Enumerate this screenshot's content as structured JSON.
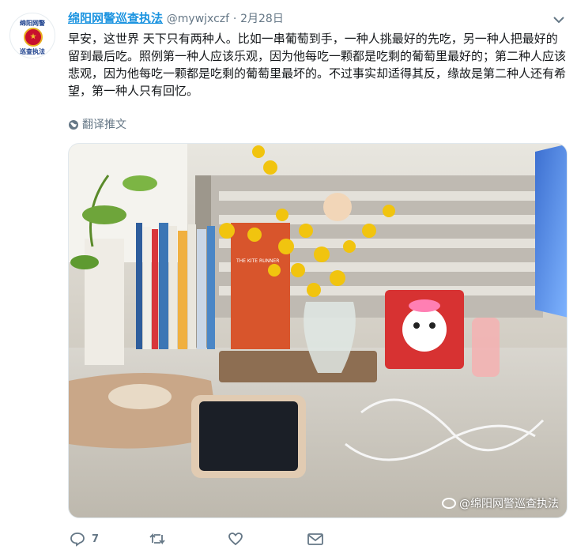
{
  "tweet": {
    "author_name": "绵阳网警巡查执法",
    "handle": "@mywjxczf",
    "separator": "·",
    "date": "2月28日",
    "text": "早安，这世界 天下只有两种人。比如一串葡萄到手，一种人挑最好的先吃，另一种人把最好的留到最后吃。照例第一种人应该乐观，因为他每吃一颗都是吃剩的葡萄里最好的；第二种人应该悲观，因为他每吃一颗都是吃剩的葡萄里最坏的。不过事实却适得其反，缘故是第二种人还有希望，第一种人只有回忆。",
    "translate_label": "翻译推文",
    "avatar": {
      "top_text": "绵阳网警",
      "bottom_text": "巡查执法"
    },
    "image_watermark": "@绵阳网警巡查执法",
    "photo_book_text": "THE KITE RUNNER"
  },
  "actions": {
    "reply_count": "7",
    "retweet_count": "",
    "like_count": "",
    "icons": [
      "reply-icon",
      "retweet-icon",
      "like-icon",
      "message-icon"
    ]
  },
  "colors": {
    "link_blue": "#1c94e0",
    "muted": "#657786",
    "text": "#14171a"
  }
}
